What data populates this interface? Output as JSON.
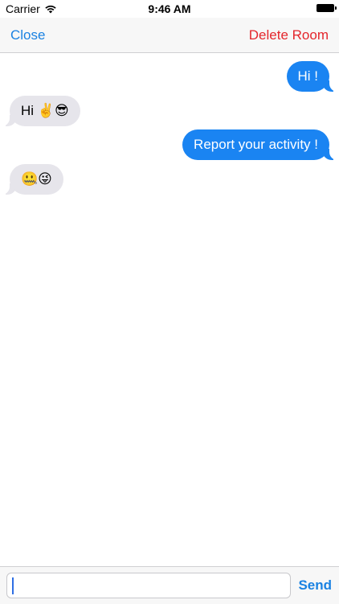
{
  "status_bar": {
    "carrier": "Carrier",
    "time": "9:46 AM"
  },
  "nav": {
    "close_label": "Close",
    "delete_label": "Delete Room"
  },
  "messages": [
    {
      "direction": "outgoing",
      "text": "Hi !"
    },
    {
      "direction": "incoming",
      "text": "Hi ✌️😎"
    },
    {
      "direction": "outgoing",
      "text": "Report your activity !"
    },
    {
      "direction": "incoming",
      "text": "🤐😜"
    }
  ],
  "composer": {
    "input_value": "",
    "placeholder": "",
    "send_label": "Send"
  },
  "colors": {
    "accent": "#1a82e2",
    "destructive": "#e4262c",
    "outgoing_bubble": "#1a84f2",
    "incoming_bubble": "#e6e5eb"
  },
  "icons": {
    "wifi": "wifi-icon",
    "battery": "battery-icon"
  }
}
